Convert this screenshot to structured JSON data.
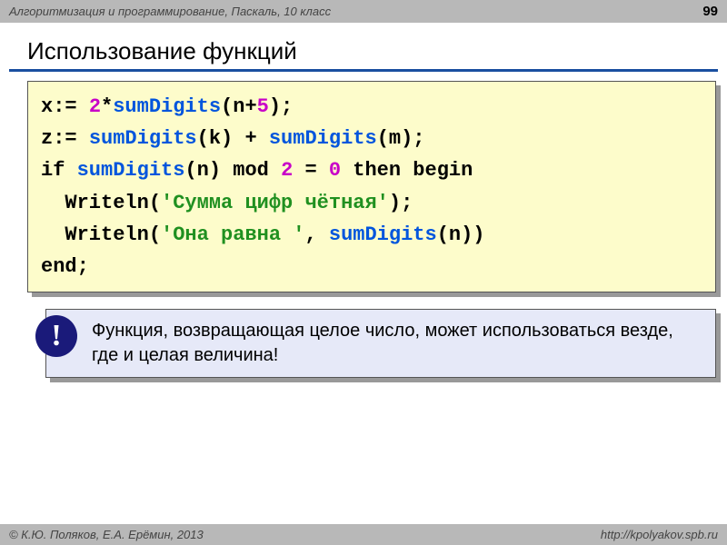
{
  "header": {
    "course": "Алгоритмизация и программирование, Паскаль, 10 класс",
    "page_number": "99"
  },
  "title": "Использование функций",
  "code": {
    "line1": {
      "pre": "x:= ",
      "n2": "2",
      "mid": "*",
      "fn": "sumDigits",
      "arg_open": "(n+",
      "n5": "5",
      "arg_close": ");"
    },
    "line2": {
      "pre": "z:= ",
      "fn1": "sumDigits",
      "mid1": "(k) + ",
      "fn2": "sumDigits",
      "mid2": "(m);"
    },
    "line3": {
      "if": "if ",
      "fn": "sumDigits",
      "arg": "(n) ",
      "mod": "mod ",
      "two": "2",
      "eq": " = ",
      "zero": "0",
      "then": " then begin"
    },
    "line4": {
      "indent": "  Writeln(",
      "str": "'Сумма цифр чётная'",
      "end": ");"
    },
    "line5": {
      "indent": "  Writeln(",
      "str": "'Она равна '",
      "comma": ", ",
      "fn": "sumDigits",
      "arg": "(n))"
    },
    "line6": {
      "end": "end;"
    }
  },
  "info": {
    "mark": "!",
    "text": "Функция, возвращающая целое число, может использоваться везде, где и целая величина!"
  },
  "footer": {
    "authors": "© К.Ю. Поляков, Е.А. Ерёмин, 2013",
    "url": "http://kpolyakov.spb.ru"
  }
}
